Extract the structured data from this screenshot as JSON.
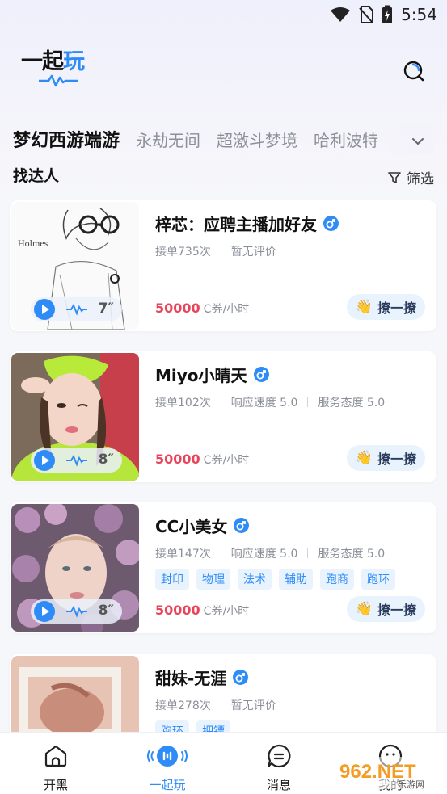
{
  "status_bar": {
    "time": "5:54",
    "icons": [
      "wifi-icon",
      "no-sim-icon",
      "battery-charging-icon"
    ]
  },
  "app": {
    "logo_prefix": "一起",
    "logo_accent": "玩",
    "brand_color": "#2f8cf6",
    "price_color": "#e8445a"
  },
  "tabs": [
    {
      "label": "梦幻西游端游",
      "active": true
    },
    {
      "label": "永劫无间",
      "active": false
    },
    {
      "label": "超激斗梦境",
      "active": false
    },
    {
      "label": "哈利波特",
      "active": false
    }
  ],
  "section": {
    "title": "找达人",
    "filter_label": "筛选"
  },
  "cards": [
    {
      "name": "梓芯：应聘主播加好友",
      "orders": "接单735次",
      "stats": [
        "暂无评价"
      ],
      "tags": [],
      "price": "50000",
      "unit": "C券/小时",
      "duration": "7″",
      "chat_label": "撩一撩"
    },
    {
      "name": "Miyo小晴天",
      "orders": "接单102次",
      "stats": [
        "响应速度 5.0",
        "服务态度 5.0"
      ],
      "tags": [],
      "price": "50000",
      "unit": "C券/小时",
      "duration": "8″",
      "chat_label": "撩一撩"
    },
    {
      "name": "CC小美女",
      "orders": "接单147次",
      "stats": [
        "响应速度 5.0",
        "服务态度 5.0"
      ],
      "tags": [
        "封印",
        "物理",
        "法术",
        "辅助",
        "跑商",
        "跑环"
      ],
      "price": "50000",
      "unit": "C券/小时",
      "duration": "8″",
      "chat_label": "撩一撩"
    },
    {
      "name": "甜妹-无涯",
      "orders": "接单278次",
      "stats": [
        "暂无评价"
      ],
      "tags": [
        "跑环",
        "押镖"
      ],
      "price": "",
      "unit": "",
      "duration": "",
      "chat_label": ""
    }
  ],
  "bottom_nav": [
    {
      "label": "开黑",
      "icon": "house-icon",
      "active": false
    },
    {
      "label": "一起玩",
      "icon": "play-together-icon",
      "active": true
    },
    {
      "label": "消息",
      "icon": "message-icon",
      "active": false
    },
    {
      "label": "我的",
      "icon": "profile-icon",
      "active": false
    }
  ],
  "watermark": {
    "text": "962.NET",
    "subtext": "乐游网"
  }
}
